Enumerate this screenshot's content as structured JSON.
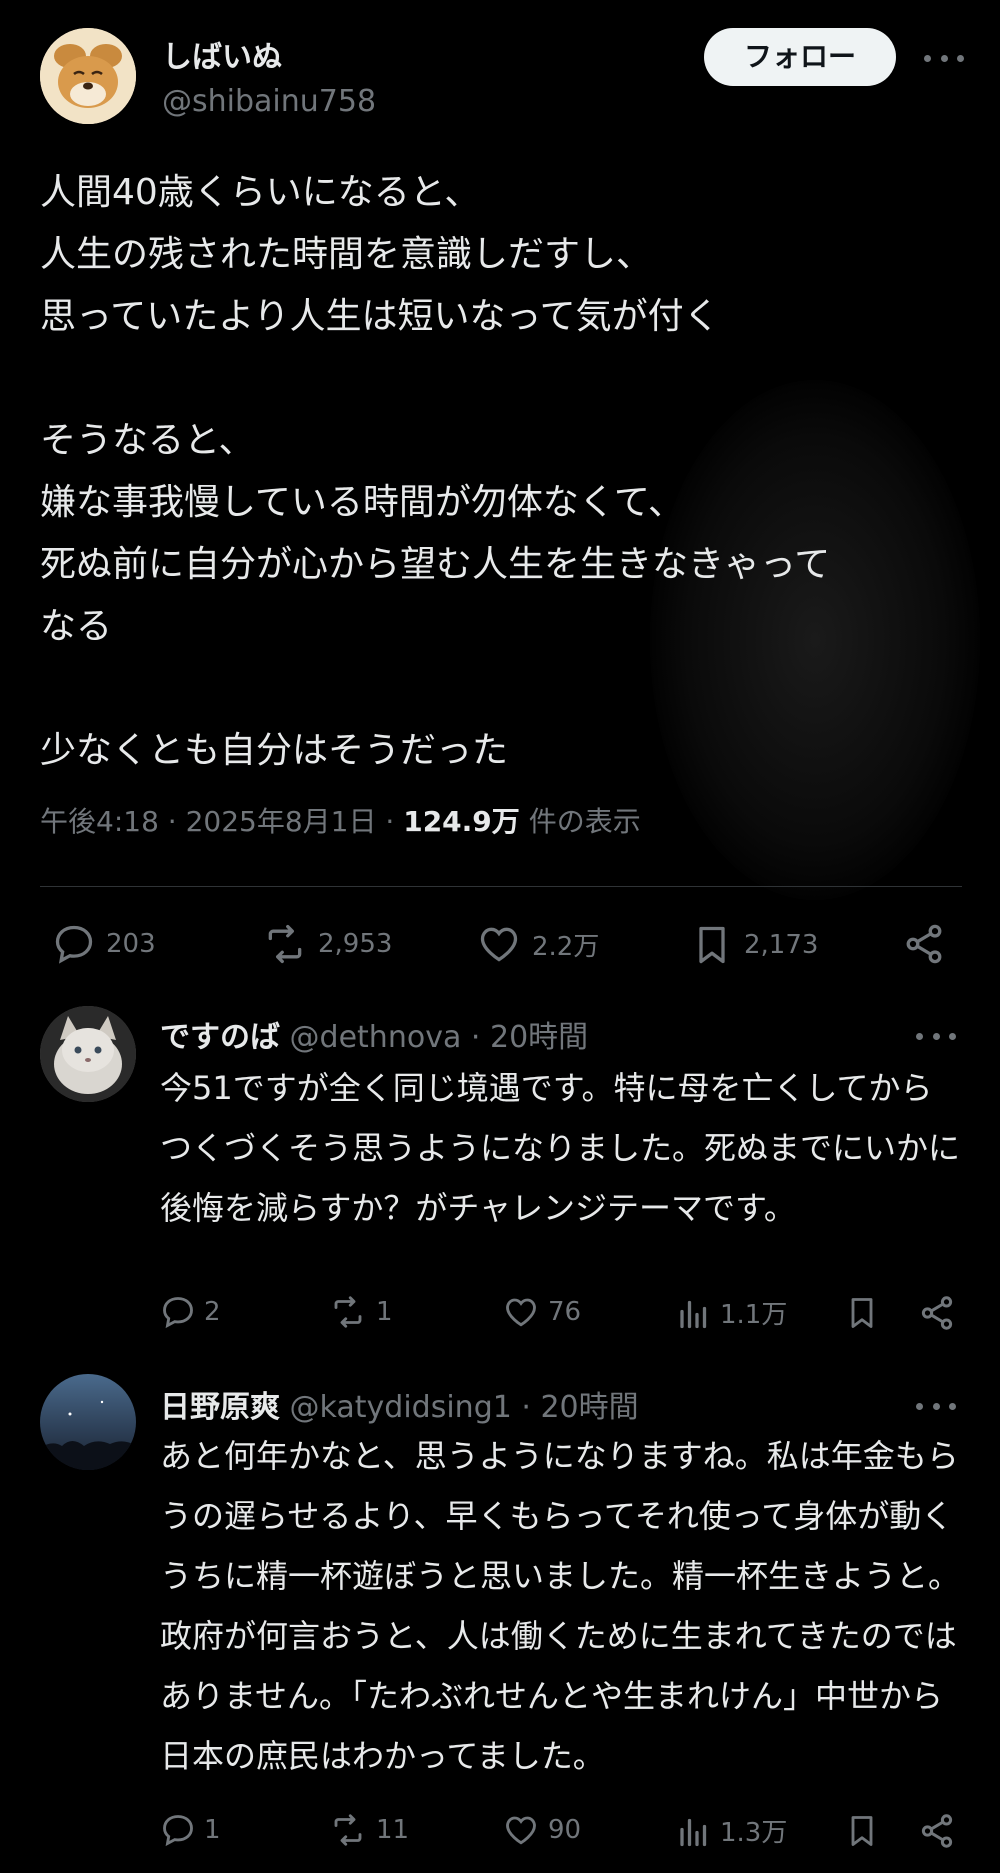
{
  "post": {
    "author_name": "しばいぬ",
    "author_handle": "@shibainu758",
    "follow_label": "フォロー",
    "text": "人間40歳くらいになると、\n人生の残された時間を意識しだすし、\n思っていたより人生は短いなって気が付く\n\nそうなると、\n嫌な事我慢している時間が勿体なくて、\n死ぬ前に自分が心から望む人生を生きなきゃって\nなる\n\n少なくとも自分はそうだった",
    "time": "午後4:18",
    "date": "2025年8月1日",
    "views_count": "124.9万",
    "views_label": "件の表示",
    "separator": "·",
    "stats": {
      "replies": "203",
      "reposts": "2,953",
      "likes": "2.2万",
      "bookmarks": "2,173"
    }
  },
  "replies": [
    {
      "name": "ですのば",
      "handle": "@dethnova",
      "age": "20時間",
      "text": "今51ですが全く同じ境遇です。特に母を亡くしてからつくづくそう思うようになりました。死ぬまでにいかに後悔を減らすか？がチャレンジテーマです。",
      "replies": "2",
      "reposts": "1",
      "likes": "76",
      "views": "1.1万"
    },
    {
      "name": "日野原爽",
      "handle": "@katydidsing1",
      "age": "20時間",
      "text": "あと何年かなと、思うようになりますね。私は年金もらうの遅らせるより、早くもらってそれ使って身体が動くうちに精一杯遊ぼうと思いました。精一杯生きようと。政府が何言おうと、人は働くために生まれてきたのではありません。「たわぶれせんとや生まれけん」中世から日本の庶民はわかってました。",
      "replies": "1",
      "reposts": "11",
      "likes": "90",
      "views": "1.3万"
    }
  ],
  "icons": [
    "reply-icon",
    "repost-icon",
    "like-icon",
    "bookmark-icon",
    "share-icon",
    "views-icon",
    "more-icon"
  ]
}
